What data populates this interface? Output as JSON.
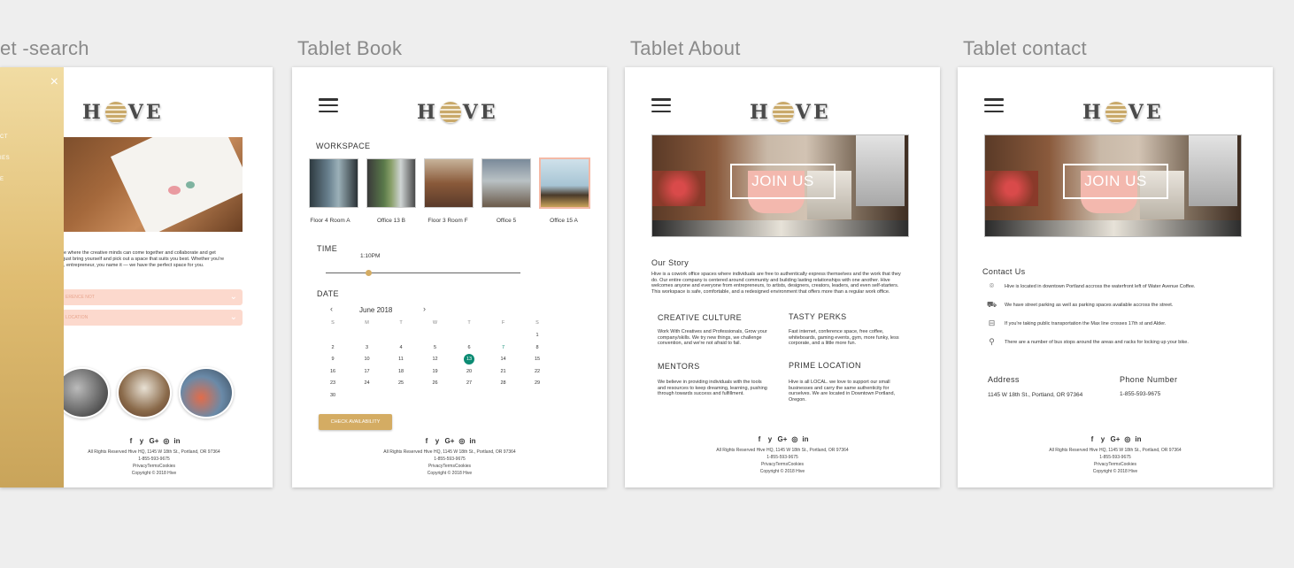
{
  "artboard_titles": [
    "et -search",
    "Tablet Book",
    "Tablet About",
    "Tablet contact"
  ],
  "brand": {
    "logo_left": "H",
    "logo_right": "VE"
  },
  "search": {
    "close_icon": "×",
    "menu_items": [
      "",
      "CT",
      "IES",
      "E"
    ],
    "intro": "e where the creative minds can come together and collaborate and get\njust bring yourself and pick out a space that suits you best. Whether you're\n, entrepreneur, you name it — we have the perfect space for you.",
    "dropdowns": [
      "ERENCE NOT",
      "LOCATION"
    ]
  },
  "book": {
    "workspace_label": "WORKSPACE",
    "workspaces": [
      "Floor 4 Room A",
      "Office 13 B",
      "Floor 3 Room F",
      "Office 5",
      "Office 15 A"
    ],
    "time_label": "TIME",
    "time_value": "1:10PM",
    "time_fraction": 0.22,
    "date_label": "DATE",
    "month": "June 2018",
    "prev": "‹",
    "next": "›",
    "dow": [
      "S",
      "M",
      "T",
      "W",
      "T",
      "F",
      "S"
    ],
    "weeks": [
      [
        "",
        "",
        "",
        "",
        "",
        "",
        "1"
      ],
      [
        "2",
        "3",
        "4",
        "5",
        "6",
        "7",
        "8"
      ],
      [
        "9",
        "10",
        "11",
        "12",
        "13",
        "14",
        "15"
      ],
      [
        "16",
        "17",
        "18",
        "19",
        "20",
        "21",
        "22"
      ],
      [
        "23",
        "24",
        "25",
        "26",
        "27",
        "28",
        "29"
      ],
      [
        "30",
        "",
        "",
        "",
        "",
        "",
        ""
      ]
    ],
    "selected_day": "13",
    "highlight_day": "7",
    "check_label": "CHECK AVAILABILITY"
  },
  "about": {
    "join_label": "JOIN US",
    "story_title": "Our Story",
    "story_text": "Hive is a cowork office spaces where individuals are free to authentically express themselves and the work that they do. Our entire company is centered around community and building lasting relationships with one another. Hive welcomes anyone and everyone from entrepreneurs, to artists, designers, creators, leaders, and even self-starters. This workspace is safe, comfortable, and a redesigned environment that offers more than a regular work office.",
    "features": [
      {
        "title": "CREATIVE CULTURE",
        "text": "Work With Creatives and Professionals, Grow your company/skills. We try new things, we challenge convention, and we're not afraid to fail."
      },
      {
        "title": "TASTY PERKS",
        "text": "Fast internet, conference space, free coffee, whiteboards, gaming events, gym, more funky, less corporate, and a little more fun."
      },
      {
        "title": "MENTORS",
        "text": "We believe in providing individuals with the tools and resources to keep dreaming, learning, pushing through towards success and fulfillment."
      },
      {
        "title": "PRIME LOCATION",
        "text": "Hive is all LOCAL. we love to support our small businesses and carry the same authenticity for ourselves. We are located in Downtown Portland, Oregon."
      }
    ]
  },
  "contact": {
    "join_label": "JOIN US",
    "title": "Contact Us",
    "rows": [
      {
        "icon": "map-pin-icon",
        "glyph": "⌾",
        "text": "Hive is located in downtown Portland accross the waterfront left of Water Avenue Coffee."
      },
      {
        "icon": "car-icon",
        "glyph": "⛟",
        "text": "We have street parking as well as parking spaces available accross the street."
      },
      {
        "icon": "bus-icon",
        "glyph": "⊟",
        "text": "If you're taking public transportation the Max line crosses 17th st and Alder."
      },
      {
        "icon": "bike-icon",
        "glyph": "⚲",
        "text": "There are a number of bus stops around the areas and racks for locking up your bike."
      }
    ],
    "address_label": "Address",
    "address_value": "1145 W 18th St., Portland, OR 97364",
    "phone_label": "Phone Number",
    "phone_value": "1-855-593-9675"
  },
  "footer": {
    "socials": [
      "f",
      "y",
      "G+",
      "◎",
      "in"
    ],
    "line1": "All Rights Reserved Hive HQ, 1145 W 18th St., Portland, OR 97364",
    "line2": "1-855-593-9675",
    "line3": "PrivacyTermsCookies",
    "line4": "Copyright © 2018 Hive"
  },
  "colors": {
    "gold": "#d4ac63",
    "pink": "#fcd9cd",
    "teal": "#0c8b73"
  }
}
